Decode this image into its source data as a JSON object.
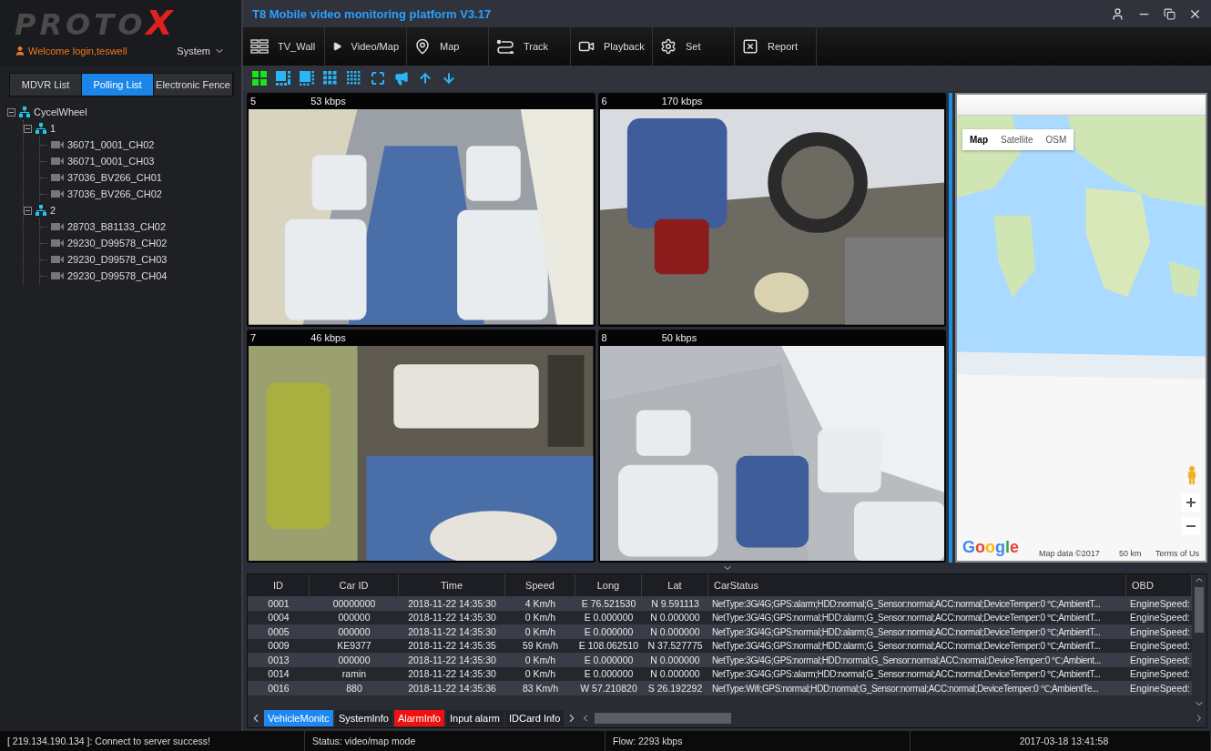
{
  "logo": {
    "text": "PROTOX"
  },
  "user": {
    "welcome": "Welcome login,teswell",
    "menu": "System"
  },
  "list_tabs": [
    {
      "label": "MDVR List",
      "selected": false
    },
    {
      "label": "Polling List",
      "selected": true
    },
    {
      "label": "Electronic Fence",
      "selected": false
    }
  ],
  "tree": [
    {
      "label": "CycelWheel",
      "expanded": true,
      "children": [
        {
          "label": "1",
          "expanded": true,
          "children": [
            {
              "label": "36071_0001_CH02"
            },
            {
              "label": "36071_0001_CH03"
            },
            {
              "label": "37036_BV266_CH01"
            },
            {
              "label": "37036_BV266_CH02"
            }
          ]
        },
        {
          "label": "2",
          "expanded": true,
          "children": [
            {
              "label": "28703_B81133_CH02"
            },
            {
              "label": "29230_D99578_CH02"
            },
            {
              "label": "29230_D99578_CH03"
            },
            {
              "label": "29230_D99578_CH04"
            }
          ]
        }
      ]
    }
  ],
  "window": {
    "title": "T8 Mobile video monitoring platform V3.17"
  },
  "nav": [
    {
      "label": "TV_Wall"
    },
    {
      "label": "Video/Map"
    },
    {
      "label": "Map"
    },
    {
      "label": "Track"
    },
    {
      "label": "Playback"
    },
    {
      "label": "Set"
    },
    {
      "label": "Report"
    }
  ],
  "toolbar": {
    "layouts": [
      {
        "selected": true
      },
      {
        "selected": false
      },
      {
        "selected": false
      },
      {
        "selected": false
      },
      {
        "selected": false
      }
    ]
  },
  "videos": [
    {
      "channel": "5",
      "bitrate": "53 kbps",
      "kind": "picture"
    },
    {
      "channel": "6",
      "bitrate": "170 kbps",
      "kind": "picture"
    },
    {
      "channel": "7",
      "bitrate": "46 kbps",
      "kind": "picture"
    },
    {
      "channel": "8",
      "bitrate": "50 kbps",
      "kind": "picture"
    }
  ],
  "map": {
    "types": [
      {
        "label": "Map",
        "selected": true
      },
      {
        "label": "Satellite",
        "selected": false
      },
      {
        "label": "OSM",
        "selected": false
      }
    ],
    "logo": "Google",
    "attribution": "Map data ©2017",
    "scale": "50 km",
    "terms": "Terms of Us"
  },
  "table": {
    "columns": [
      "ID",
      "Car ID",
      "Time",
      "Speed",
      "Long",
      "Lat",
      "CarStatus",
      "OBD"
    ],
    "rows": [
      {
        "id": "0001",
        "car_id": "00000000",
        "time": "2018-11-22 14:35:30",
        "speed": "4 Km/h",
        "long": "E 76.521530",
        "lat": "N 9.591113",
        "status": "NetType:3G/4G;GPS:alarm;HDD:normal;G_Sensor:normal;ACC:normal;DeviceTemper:0 ℃;AmbientT...",
        "obd": "EngineSpeed:"
      },
      {
        "id": "0004",
        "car_id": "000000",
        "time": "2018-11-22 14:35:30",
        "speed": "0 Km/h",
        "long": "E 0.000000",
        "lat": "N 0.000000",
        "status": "NetType:3G/4G;GPS:normal;HDD:alarm;G_Sensor:normal;ACC:normal;DeviceTemper:0 ℃;AmbientT...",
        "obd": "EngineSpeed:"
      },
      {
        "id": "0005",
        "car_id": "000000",
        "time": "2018-11-22 14:35:30",
        "speed": "0 Km/h",
        "long": "E 0.000000",
        "lat": "N 0.000000",
        "status": "NetType:3G/4G;GPS:normal;HDD:alarm;G_Sensor:normal;ACC:normal;DeviceTemper:0 ℃;AmbientT...",
        "obd": "EngineSpeed:"
      },
      {
        "id": "0009",
        "car_id": "KE9377",
        "time": "2018-11-22 14:35:35",
        "speed": "59 Km/h",
        "long": "E 108.062510",
        "lat": "N 37.527775",
        "status": "NetType:3G/4G;GPS:normal;HDD:alarm;G_Sensor:normal;ACC:normal;DeviceTemper:0 ℃;AmbientT...",
        "obd": "EngineSpeed:"
      },
      {
        "id": "0013",
        "car_id": "000000",
        "time": "2018-11-22 14:35:30",
        "speed": "0 Km/h",
        "long": "E 0.000000",
        "lat": "N 0.000000",
        "status": "NetType:3G/4G;GPS:normal;HDD:normal;G_Sensor:normal;ACC:normal;DeviceTemper:0 ℃;Ambient...",
        "obd": "EngineSpeed:"
      },
      {
        "id": "0014",
        "car_id": "ramin",
        "time": "2018-11-22 14:35:30",
        "speed": "0 Km/h",
        "long": "E 0.000000",
        "lat": "N 0.000000",
        "status": "NetType:3G/4G;GPS:alarm;HDD:normal;G_Sensor:normal;ACC:normal;DeviceTemper:0 ℃;AmbientT...",
        "obd": "EngineSpeed:"
      },
      {
        "id": "0016",
        "car_id": "880",
        "time": "2018-11-22 14:35:36",
        "speed": "83 Km/h",
        "long": "W 57.210820",
        "lat": "S 26.192292",
        "status": "NetType:Wifi;GPS:normal;HDD:normal;G_Sensor:normal;ACC:normal;DeviceTemper:0 ℃;AmbientTe...",
        "obd": "EngineSpeed:"
      }
    ]
  },
  "bottom_tabs": [
    {
      "label": "VehicleMonitc",
      "selected": true,
      "alert": false
    },
    {
      "label": "SystemInfo",
      "selected": false,
      "alert": false
    },
    {
      "label": "AlarmInfo",
      "selected": false,
      "alert": true
    },
    {
      "label": "Input alarm",
      "selected": false,
      "alert": false
    },
    {
      "label": "IDCard Info",
      "selected": false,
      "alert": false
    }
  ],
  "status_bar": [
    "[ 219.134.190.134 ]: Connect to server success!",
    "Status: video/map mode",
    "Flow: 2293 kbps",
    "2017-03-18 13:41:58"
  ]
}
